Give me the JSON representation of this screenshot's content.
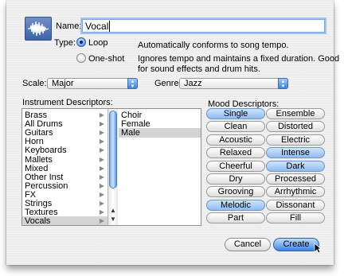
{
  "dialog": {
    "name_label": "Name:",
    "name_value": "Vocal",
    "type_label": "Type:",
    "loop_label": "Loop",
    "loop_desc": "Automatically conforms to song tempo.",
    "oneshot_label": "One-shot",
    "oneshot_desc_line1": "Ignores tempo and maintains a fixed duration. Good",
    "oneshot_desc_line2": "for sound effects and drum hits.",
    "type_selected": "Loop",
    "scale_label": "Scale:",
    "scale_value": "Major",
    "genre_label": "Genre:",
    "genre_value": "Jazz",
    "instrument_heading": "Instrument Descriptors:",
    "mood_heading": "Mood Descriptors:",
    "instruments": [
      "Brass",
      "All Drums",
      "Guitars",
      "Horn",
      "Keyboards",
      "Mallets",
      "Mixed",
      "Other Inst",
      "Percussion",
      "FX",
      "Strings",
      "Textures",
      "Vocals"
    ],
    "instrument_selected": "Vocals",
    "subcategories": [
      "Choir",
      "Female",
      "Male"
    ],
    "subcategory_selected": "Male",
    "moods": [
      [
        "Single",
        "Ensemble"
      ],
      [
        "Clean",
        "Distorted"
      ],
      [
        "Acoustic",
        "Electric"
      ],
      [
        "Relaxed",
        "Intense"
      ],
      [
        "Cheerful",
        "Dark"
      ],
      [
        "Dry",
        "Processed"
      ],
      [
        "Grooving",
        "Arrhythmic"
      ],
      [
        "Melodic",
        "Dissonant"
      ],
      [
        "Part",
        "Fill"
      ]
    ],
    "moods_selected": [
      "Single",
      "Intense",
      "Dark",
      "Melodic"
    ],
    "cancel_label": "Cancel",
    "create_label": "Create",
    "accent_color": "#3d82e0"
  }
}
